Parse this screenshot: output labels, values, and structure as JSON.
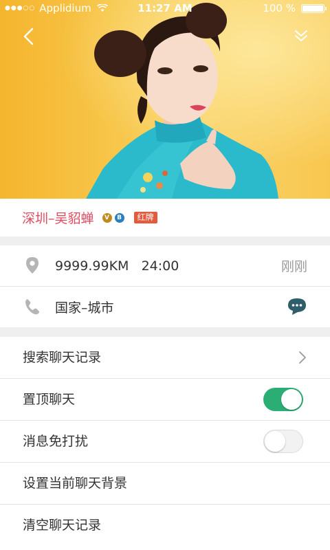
{
  "status_bar": {
    "carrier": "Applidium",
    "time": "11:27 AM",
    "battery": "100 %",
    "signal_icon": "signal-dots-icon",
    "wifi_icon": "wifi-icon",
    "battery_icon": "battery-icon"
  },
  "nav": {
    "back_icon": "chevron-left-icon",
    "more_icon": "double-chevron-down-icon"
  },
  "profile": {
    "name": "深圳–吴貂蝉",
    "badge_v": "V",
    "badge_b": "B",
    "badge_label": "红牌"
  },
  "info": {
    "distance": "9999.99KM",
    "duration": "24:00",
    "time_ago": "刚刚",
    "location": "国家–城市",
    "location_icon": "map-pin-icon",
    "phone_icon": "phone-icon",
    "chat_icon": "chat-bubble-icon"
  },
  "settings": [
    {
      "label": "搜索聊天记录",
      "type": "link"
    },
    {
      "label": "置顶聊天",
      "type": "toggle",
      "enabled": true
    },
    {
      "label": "消息免打扰",
      "type": "toggle",
      "enabled": false
    },
    {
      "label": "设置当前聊天背景",
      "type": "link"
    },
    {
      "label": "清空聊天记录",
      "type": "link"
    }
  ],
  "colors": {
    "accent_green": "#2bae74",
    "name_red": "#e24a60",
    "badge_red": "#e35a3c",
    "hero_yellow": "#f7c64a"
  }
}
